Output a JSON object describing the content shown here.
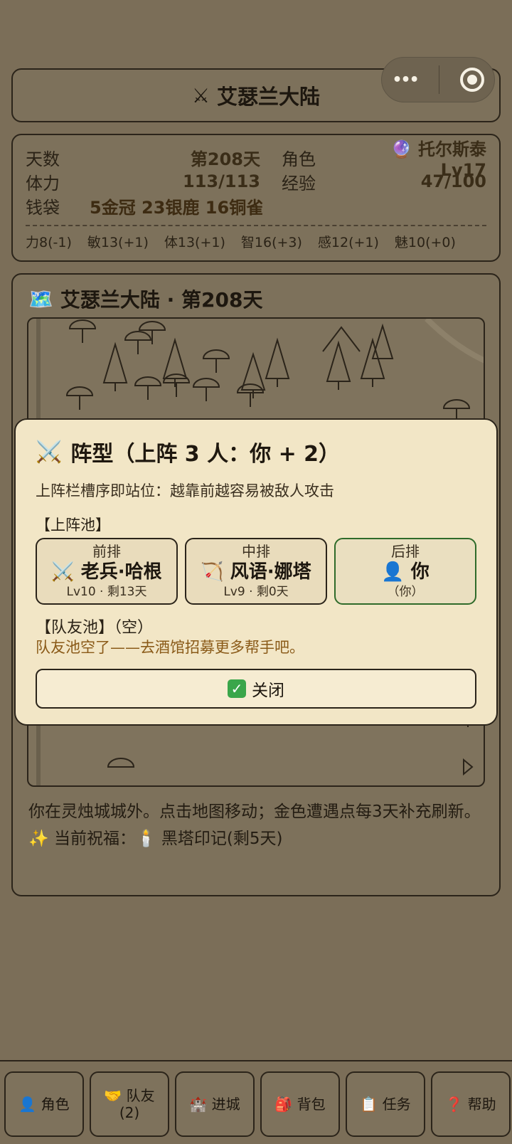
{
  "header": {
    "title": "艾瑟兰大陆",
    "icon": "crossed-swords-icon"
  },
  "capsule": {
    "more_label": "•••"
  },
  "stats": {
    "days_label": "天数",
    "days_value": "第208天",
    "role_label": "角色",
    "role_value": "托尔斯泰 Lv17",
    "stamina_label": "体力",
    "stamina_value": "113/113",
    "exp_label": "经验",
    "exp_value": "47/100",
    "purse_label": "钱袋",
    "purse_value": "5金冠 23银鹿 16铜雀",
    "attributes": [
      "力8(-1)",
      "敏13(+1)",
      "体13(+1)",
      "智16(+3)",
      "感12(+1)",
      "魅10(+0)"
    ]
  },
  "map": {
    "title": "艾瑟兰大陆 · 第208天",
    "note": "你在灵烛城城外。点击地图移动；金色遭遇点每3天补充刷新。",
    "blessing": "✨ 当前祝福：🕯️ 黑塔印记(剩5天)"
  },
  "modal": {
    "title": "阵型（上阵 3 人：你 + 2）",
    "subtitle": "上阵栏槽序即站位：越靠前越容易被敌人攻击",
    "lineup_label": "【上阵池】",
    "slots": [
      {
        "position": "前排",
        "icon": "⚔️",
        "name": "老兵·哈根",
        "meta": "Lv10 · 剩13天"
      },
      {
        "position": "中排",
        "icon": "🏹",
        "name": "风语·娜塔",
        "meta": "Lv9 · 剩0天"
      },
      {
        "position": "后排",
        "icon": "👤",
        "name": "你",
        "meta": "（你）"
      }
    ],
    "pool_label": "【队友池】（空）",
    "pool_empty": "队友池空了——去酒馆招募更多帮手吧。",
    "close_label": "关闭"
  },
  "nav": [
    {
      "icon": "👤",
      "label": "角色"
    },
    {
      "icon": "🤝",
      "label": "队友",
      "sub": "(2)"
    },
    {
      "icon": "🏰",
      "label": "进城"
    },
    {
      "icon": "🎒",
      "label": "背包"
    },
    {
      "icon": "📋",
      "label": "任务"
    },
    {
      "icon": "❓",
      "label": "帮助"
    }
  ]
}
